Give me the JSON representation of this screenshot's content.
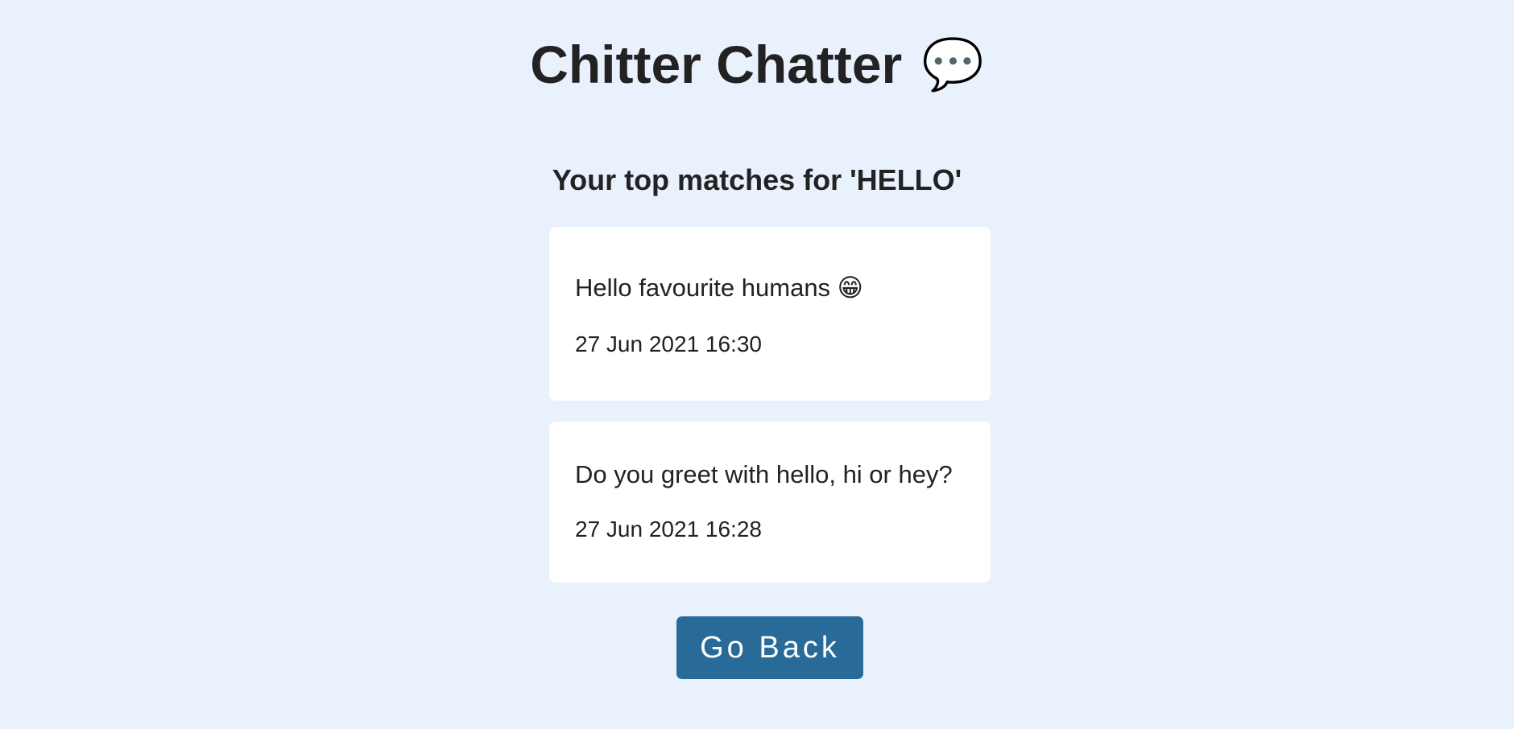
{
  "app": {
    "title": "Chitter Chatter",
    "title_emoji": "💬",
    "title_icon": "speech-balloon-icon"
  },
  "results": {
    "heading": "Your top matches for 'HELLO'",
    "items": [
      {
        "message": "Hello favourite humans 😁",
        "timestamp": "27 Jun 2021 16:30"
      },
      {
        "message": "Do you greet with hello, hi or hey?",
        "timestamp": "27 Jun 2021 16:28"
      }
    ]
  },
  "actions": {
    "back_label": "Go Back"
  },
  "colors": {
    "background": "#e9f1fd",
    "card": "#ffffff",
    "button": "#296b98",
    "text": "#222222"
  }
}
